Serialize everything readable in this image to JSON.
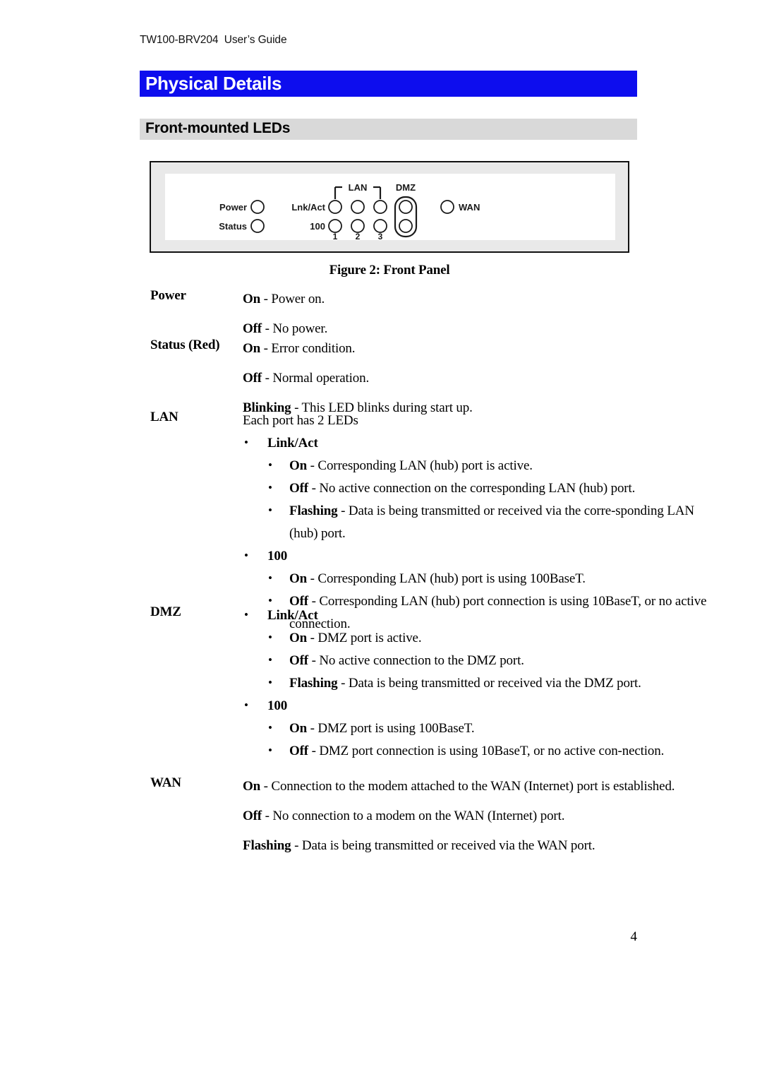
{
  "header": {
    "running_header": "TW100-BRV204  User’s Guide"
  },
  "chapter": {
    "title": "Physical Details",
    "bar_color": "#0d0dee",
    "text_color": "#ffffff"
  },
  "section": {
    "title": "Front-mounted LEDs",
    "bar_color": "#d9d9d9",
    "text_color": "#000000"
  },
  "figure": {
    "caption": "Figure 2: Front Panel",
    "panel": {
      "labels": {
        "power": "Power",
        "status": "Status",
        "link_act": "Lnk/Act",
        "hundred": "100",
        "lan_group": "LAN",
        "dmz_group": "DMZ",
        "wan": "WAN",
        "port_numbers": [
          "1",
          "2",
          "3"
        ]
      }
    }
  },
  "led_table": [
    {
      "term": "Power",
      "lines": [
        {
          "indent": 0,
          "bold": "On",
          "rest": " - Power on."
        },
        {
          "indent": 0,
          "bold": "Off",
          "rest": " - No power."
        }
      ]
    },
    {
      "term": "Status (Red)",
      "lines": [
        {
          "indent": 0,
          "bold": "On",
          "rest": " - Error condition."
        },
        {
          "indent": 0,
          "bold": "Off",
          "rest": " - Normal operation."
        },
        {
          "indent": 0,
          "bold": "Blinking",
          "rest": " - This LED blinks during start up."
        }
      ]
    },
    {
      "term": "LAN",
      "lines": [
        {
          "indent": 0,
          "bold": "",
          "rest": "Each port has 2 LEDs"
        },
        {
          "indent": 1,
          "bold": "Link/Act",
          "rest": ""
        },
        {
          "indent": 2,
          "bold": "On",
          "rest": " - Corresponding LAN (hub) port is active."
        },
        {
          "indent": 2,
          "bold": "Off",
          "rest": " - No active connection on the corresponding LAN (hub) port."
        },
        {
          "indent": 2,
          "bold": "Flashing",
          "rest": " - Data is being transmitted or received via the corre-sponding LAN (hub) port."
        },
        {
          "indent": 1,
          "bold": "100",
          "rest": ""
        },
        {
          "indent": 2,
          "bold": "On",
          "rest": " - Corresponding LAN (hub) port is using 100BaseT."
        },
        {
          "indent": 2,
          "bold": "Off",
          "rest": " - Corresponding LAN (hub) port connection is using 10BaseT, or no active connection."
        }
      ]
    },
    {
      "term": "DMZ",
      "lines": [
        {
          "indent": 1,
          "bold": "Link/Act",
          "rest": ""
        },
        {
          "indent": 2,
          "bold": "On",
          "rest": " - DMZ port is active."
        },
        {
          "indent": 2,
          "bold": "Off",
          "rest": " - No active connection to the DMZ port."
        },
        {
          "indent": 2,
          "bold": "Flashing",
          "rest": " - Data is being transmitted or received via the DMZ port."
        },
        {
          "indent": 1,
          "bold": "100",
          "rest": ""
        },
        {
          "indent": 2,
          "bold": "On",
          "rest": " - DMZ port is using 100BaseT."
        },
        {
          "indent": 2,
          "bold": "Off",
          "rest": " - DMZ port connection is using 10BaseT, or no active con-nection."
        }
      ]
    },
    {
      "term": "WAN",
      "lines": [
        {
          "indent": 0,
          "bold": "On",
          "rest": " - Connection to the modem attached to the WAN (Internet) port is established."
        },
        {
          "indent": 0,
          "bold": "Off",
          "rest": " - No connection to a modem on the WAN (Internet) port."
        },
        {
          "indent": 0,
          "bold": "Flashing",
          "rest": " - Data is being transmitted or received via the WAN port."
        }
      ]
    }
  ],
  "footer": {
    "page_number": "4"
  }
}
